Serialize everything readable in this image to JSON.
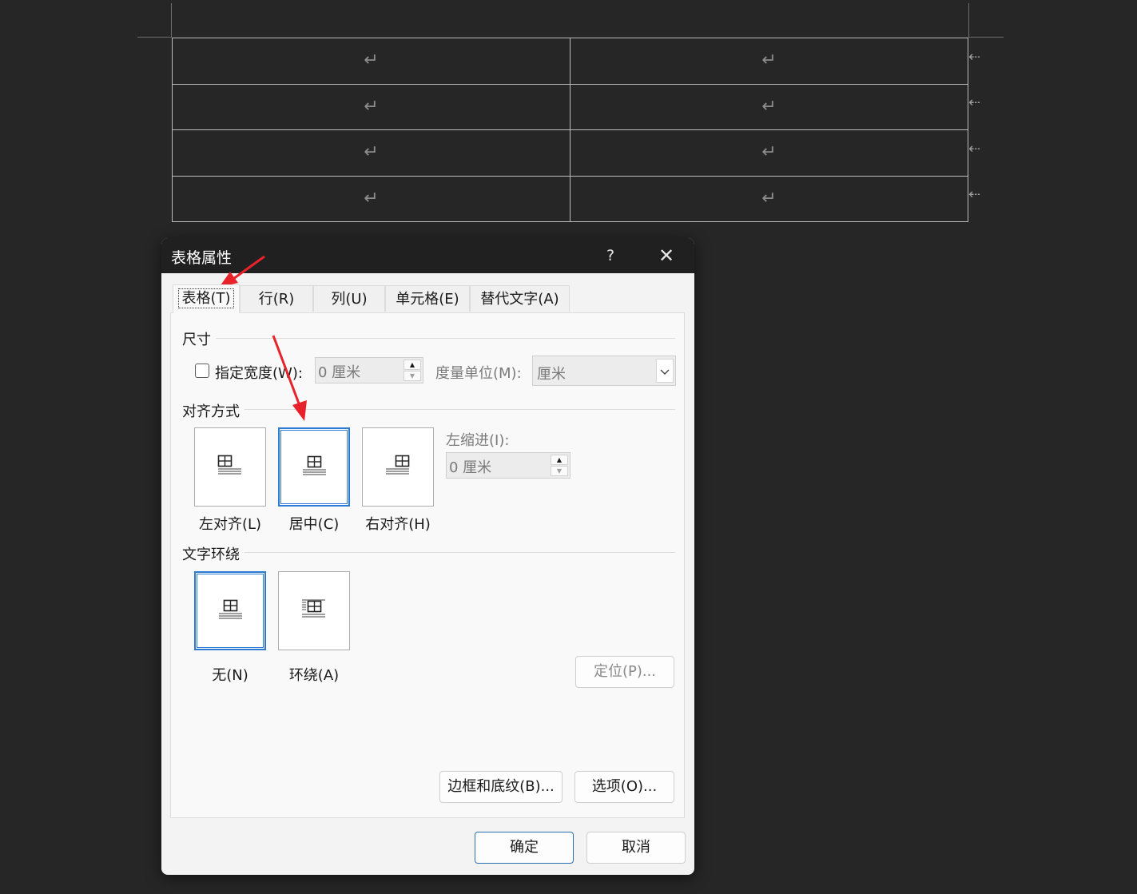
{
  "document": {
    "paragraph_mark": "↵",
    "row_end_mark": "⇠",
    "rows": 4,
    "cols": 2
  },
  "dialog": {
    "title": "表格属性",
    "help_glyph": "?",
    "close_glyph": "✕",
    "tabs": [
      {
        "label": "表格(T)",
        "active": true
      },
      {
        "label": "行(R)",
        "active": false
      },
      {
        "label": "列(U)",
        "active": false
      },
      {
        "label": "单元格(E)",
        "active": false
      },
      {
        "label": "替代文字(A)",
        "active": false
      }
    ],
    "size": {
      "section_title": "尺寸",
      "specify_width_label": "指定宽度(W):",
      "specify_width_checked": false,
      "width_value": "0 厘米",
      "measure_label": "度量单位(M):",
      "measure_value": "厘米"
    },
    "alignment": {
      "section_title": "对齐方式",
      "options": [
        {
          "label": "左对齐(L)",
          "selected": false
        },
        {
          "label": "居中(C)",
          "selected": true
        },
        {
          "label": "右对齐(H)",
          "selected": false
        }
      ],
      "indent_label": "左缩进(I):",
      "indent_value": "0 厘米"
    },
    "wrapping": {
      "section_title": "文字环绕",
      "options": [
        {
          "label": "无(N)",
          "selected": true
        },
        {
          "label": "环绕(A)",
          "selected": false
        }
      ],
      "position_button": "定位(P)..."
    },
    "buttons": {
      "borders": "边框和底纹(B)...",
      "options": "选项(O)...",
      "ok": "确定",
      "cancel": "取消"
    }
  },
  "colors": {
    "background": "#262626",
    "title_bar": "#202020",
    "selection_blue": "#2b7ad6",
    "annotation_red": "#e8222a"
  }
}
